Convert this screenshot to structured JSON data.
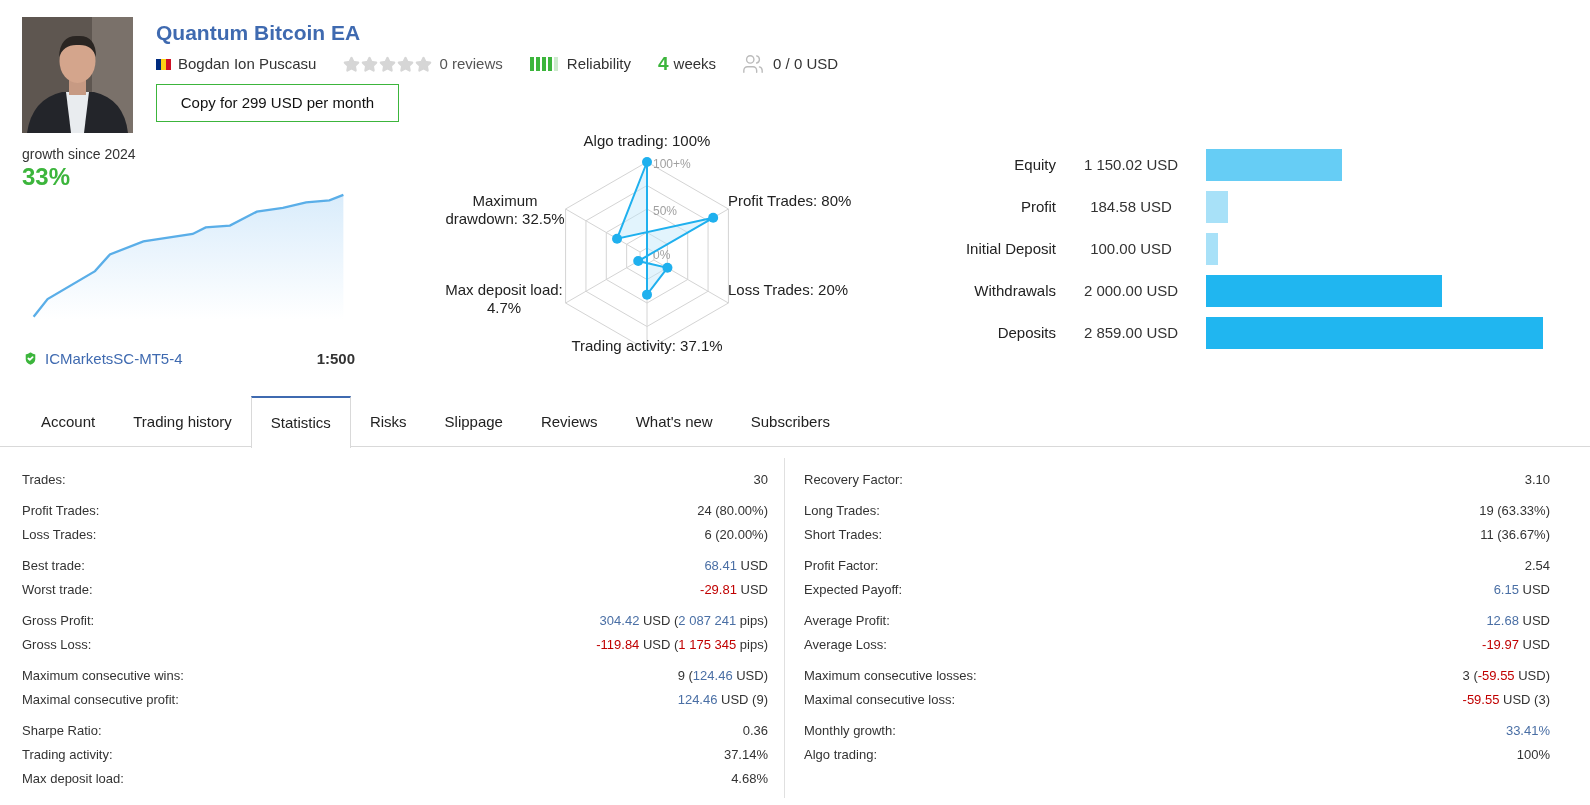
{
  "header": {
    "title": "Quantum Bitcoin EA",
    "author": "Bogdan Ion Puscasu",
    "rating": {
      "stars": 0,
      "label": "0 reviews"
    },
    "reliability": {
      "level": 0.8,
      "label": "Reliability"
    },
    "age": {
      "number": "4",
      "unit": "weeks"
    },
    "subscribers": "0 / 0 USD",
    "copy_button": "Copy for 299 USD per month"
  },
  "growth": {
    "caption": "growth since 2024",
    "value": "33%",
    "broker": "ICMarketsSC-MT5-4",
    "leverage": "1:500"
  },
  "radar": {
    "ticks": [
      "100+%",
      "50%",
      "0%"
    ],
    "axes": [
      {
        "label": "Algo trading: 100%"
      },
      {
        "label": "Maximum drawdown: 32.5%"
      },
      {
        "label": "Profit Trades: 80%"
      },
      {
        "label": "Max deposit load: 4.7%"
      },
      {
        "label": "Loss Trades: 20%"
      },
      {
        "label": "Trading activity: 37.1%"
      }
    ]
  },
  "balances": [
    {
      "label": "Equity",
      "value": "1 150.02 USD",
      "color": "#66cdf5"
    },
    {
      "label": "Profit",
      "value": "184.58 USD",
      "color": "#a8e1f8"
    },
    {
      "label": "Initial Deposit",
      "value": "100.00 USD",
      "color": "#a8e1f8"
    },
    {
      "label": "Withdrawals",
      "value": "2 000.00 USD",
      "color": "#20b6f0"
    },
    {
      "label": "Deposits",
      "value": "2 859.00 USD",
      "color": "#20b6f0"
    }
  ],
  "tabs": [
    {
      "label": "Account",
      "selected": false
    },
    {
      "label": "Trading history",
      "selected": false
    },
    {
      "label": "Statistics",
      "selected": true
    },
    {
      "label": "Risks",
      "selected": false
    },
    {
      "label": "Slippage",
      "selected": false
    },
    {
      "label": "Reviews",
      "selected": false
    },
    {
      "label": "What's new",
      "selected": false
    },
    {
      "label": "Subscribers",
      "selected": false
    }
  ],
  "statistics": {
    "left": [
      [
        {
          "label": "Trades:",
          "value": [
            {
              "text": "30",
              "kind": "plain"
            }
          ]
        }
      ],
      [
        {
          "label": "Profit Trades:",
          "value": [
            {
              "text": "24 (80.00%)",
              "kind": "plain"
            }
          ]
        },
        {
          "label": "Loss Trades:",
          "value": [
            {
              "text": "6 (20.00%)",
              "kind": "plain"
            }
          ]
        }
      ],
      [
        {
          "label": "Best trade:",
          "value": [
            {
              "text": "68.41",
              "kind": "positive"
            },
            {
              "text": " USD",
              "kind": "plain"
            }
          ]
        },
        {
          "label": "Worst trade:",
          "value": [
            {
              "text": "-29.81",
              "kind": "negative"
            },
            {
              "text": " USD",
              "kind": "plain"
            }
          ]
        }
      ],
      [
        {
          "label": "Gross Profit:",
          "value": [
            {
              "text": "304.42",
              "kind": "positive"
            },
            {
              "text": " USD (",
              "kind": "plain"
            },
            {
              "text": "2 087 241",
              "kind": "positive"
            },
            {
              "text": " pips)",
              "kind": "plain"
            }
          ]
        },
        {
          "label": "Gross Loss:",
          "value": [
            {
              "text": "-119.84",
              "kind": "negative"
            },
            {
              "text": " USD (",
              "kind": "plain"
            },
            {
              "text": "1 175 345",
              "kind": "negative"
            },
            {
              "text": " pips)",
              "kind": "plain"
            }
          ]
        }
      ],
      [
        {
          "label": "Maximum consecutive wins:",
          "value": [
            {
              "text": "9 (",
              "kind": "plain"
            },
            {
              "text": "124.46",
              "kind": "positive"
            },
            {
              "text": " USD)",
              "kind": "plain"
            }
          ]
        },
        {
          "label": "Maximal consecutive profit:",
          "value": [
            {
              "text": "124.46",
              "kind": "positive"
            },
            {
              "text": " USD (9)",
              "kind": "plain"
            }
          ]
        }
      ],
      [
        {
          "label": "Sharpe Ratio:",
          "value": [
            {
              "text": "0.36",
              "kind": "plain"
            }
          ]
        },
        {
          "label": "Trading activity:",
          "value": [
            {
              "text": "37.14%",
              "kind": "plain"
            }
          ]
        },
        {
          "label": "Max deposit load:",
          "value": [
            {
              "text": "4.68%",
              "kind": "plain"
            }
          ]
        }
      ]
    ],
    "right": [
      [
        {
          "label": "Recovery Factor:",
          "value": [
            {
              "text": "3.10",
              "kind": "plain"
            }
          ]
        }
      ],
      [
        {
          "label": "Long Trades:",
          "value": [
            {
              "text": "19 (63.33%)",
              "kind": "plain"
            }
          ]
        },
        {
          "label": "Short Trades:",
          "value": [
            {
              "text": "11 (36.67%)",
              "kind": "plain"
            }
          ]
        }
      ],
      [
        {
          "label": "Profit Factor:",
          "value": [
            {
              "text": "2.54",
              "kind": "plain"
            }
          ]
        },
        {
          "label": "Expected Payoff:",
          "value": [
            {
              "text": "6.15",
              "kind": "positive"
            },
            {
              "text": " USD",
              "kind": "plain"
            }
          ]
        }
      ],
      [
        {
          "label": "Average Profit:",
          "value": [
            {
              "text": "12.68",
              "kind": "positive"
            },
            {
              "text": " USD",
              "kind": "plain"
            }
          ]
        },
        {
          "label": "Average Loss:",
          "value": [
            {
              "text": "-19.97",
              "kind": "negative"
            },
            {
              "text": " USD",
              "kind": "plain"
            }
          ]
        }
      ],
      [
        {
          "label": "Maximum consecutive losses:",
          "value": [
            {
              "text": "3 (",
              "kind": "plain"
            },
            {
              "text": "-59.55",
              "kind": "negative"
            },
            {
              "text": " USD)",
              "kind": "plain"
            }
          ]
        },
        {
          "label": "Maximal consecutive loss:",
          "value": [
            {
              "text": "-59.55",
              "kind": "negative"
            },
            {
              "text": " USD (3)",
              "kind": "plain"
            }
          ]
        }
      ],
      [
        {
          "label": "Monthly growth:",
          "value": [
            {
              "text": "33.41%",
              "kind": "positive"
            }
          ]
        },
        {
          "label": "Algo trading:",
          "value": [
            {
              "text": "100%",
              "kind": "plain"
            }
          ]
        }
      ]
    ]
  }
}
